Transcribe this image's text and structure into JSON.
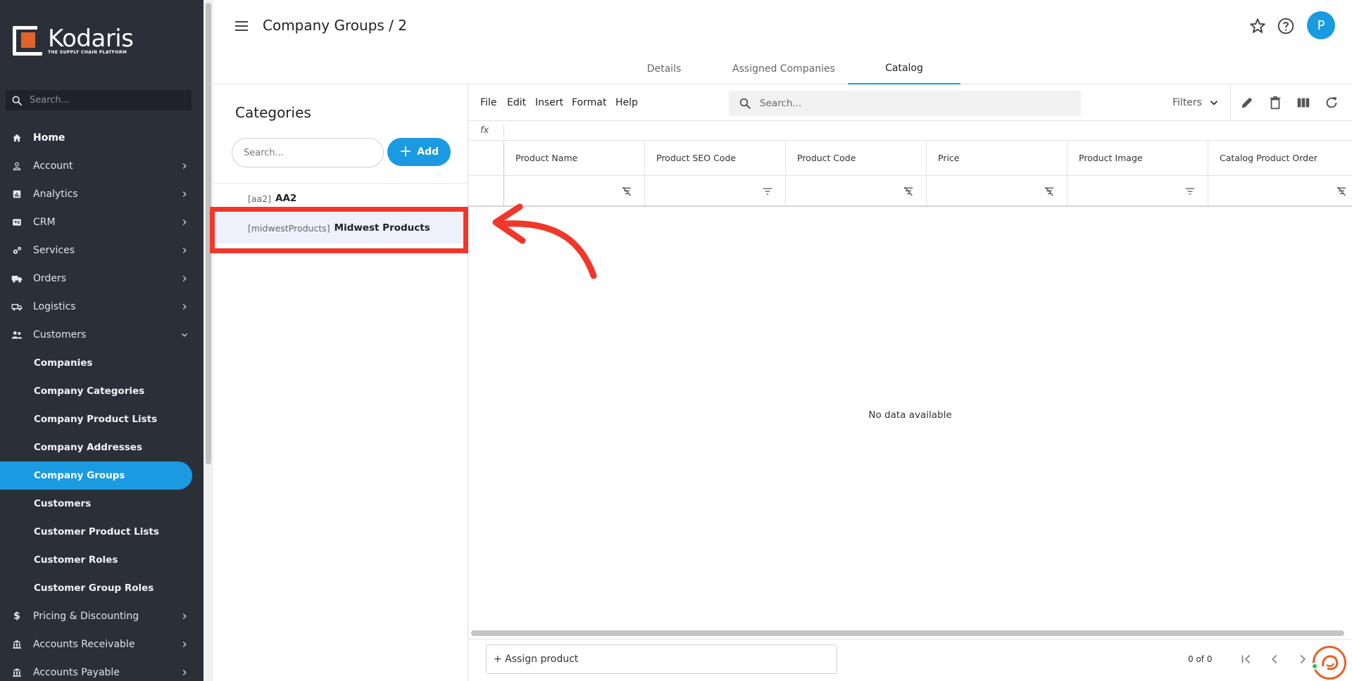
{
  "sidebar": {
    "logo": {
      "name": "Kodaris",
      "tagline": "THE SUPPLY CHAIN PLATFORM"
    },
    "search_placeholder": "Search...",
    "items": [
      {
        "label": "Home",
        "icon": "home-icon"
      },
      {
        "label": "Account",
        "icon": "person-icon"
      },
      {
        "label": "Analytics",
        "icon": "analytics-icon"
      },
      {
        "label": "CRM",
        "icon": "contact-card-icon"
      },
      {
        "label": "Services",
        "icon": "gears-icon"
      },
      {
        "label": "Orders",
        "icon": "truck-icon"
      },
      {
        "label": "Logistics",
        "icon": "shipping-icon"
      },
      {
        "label": "Customers",
        "icon": "people-icon"
      }
    ],
    "customer_subitems": [
      "Companies",
      "Company Categories",
      "Company Product Lists",
      "Company Addresses",
      "Company Groups",
      "Customers",
      "Customer Product Lists",
      "Customer Roles",
      "Customer Group Roles"
    ],
    "active_subitem": "Company Groups",
    "bottom_items": [
      {
        "label": "Pricing & Discounting",
        "icon": "dollar-icon"
      },
      {
        "label": "Accounts Receivable",
        "icon": "bank-icon"
      },
      {
        "label": "Accounts Payable",
        "icon": "bank-icon"
      }
    ]
  },
  "header": {
    "title": "Company Groups / 2",
    "avatar_initial": "P",
    "tabs": [
      "Details",
      "Assigned Companies",
      "Catalog"
    ],
    "active_tab": "Catalog"
  },
  "categories": {
    "title": "Categories",
    "search_placeholder": "Search...",
    "add_label": "Add",
    "rows": [
      {
        "code": "[aa2]",
        "name": "AA2"
      },
      {
        "code": "[midwestProducts]",
        "name": "Midwest Products"
      }
    ]
  },
  "grid": {
    "menu": [
      "File",
      "Edit",
      "Insert",
      "Format",
      "Help"
    ],
    "search_placeholder": "Search...",
    "filters_label": "Filters",
    "fx_label": "fx",
    "columns": [
      "Product Name",
      "Product SEO Code",
      "Product Code",
      "Price",
      "Product Image",
      "Catalog Product Order"
    ],
    "empty_message": "No data available",
    "assign_label": "+ Assign product",
    "pager_text": "0 of 0"
  },
  "colors": {
    "sidebar_bg": "#2b3038",
    "accent": "#1a9ae0",
    "highlight": "#f2362a",
    "brand_orange": "#e2632a"
  }
}
